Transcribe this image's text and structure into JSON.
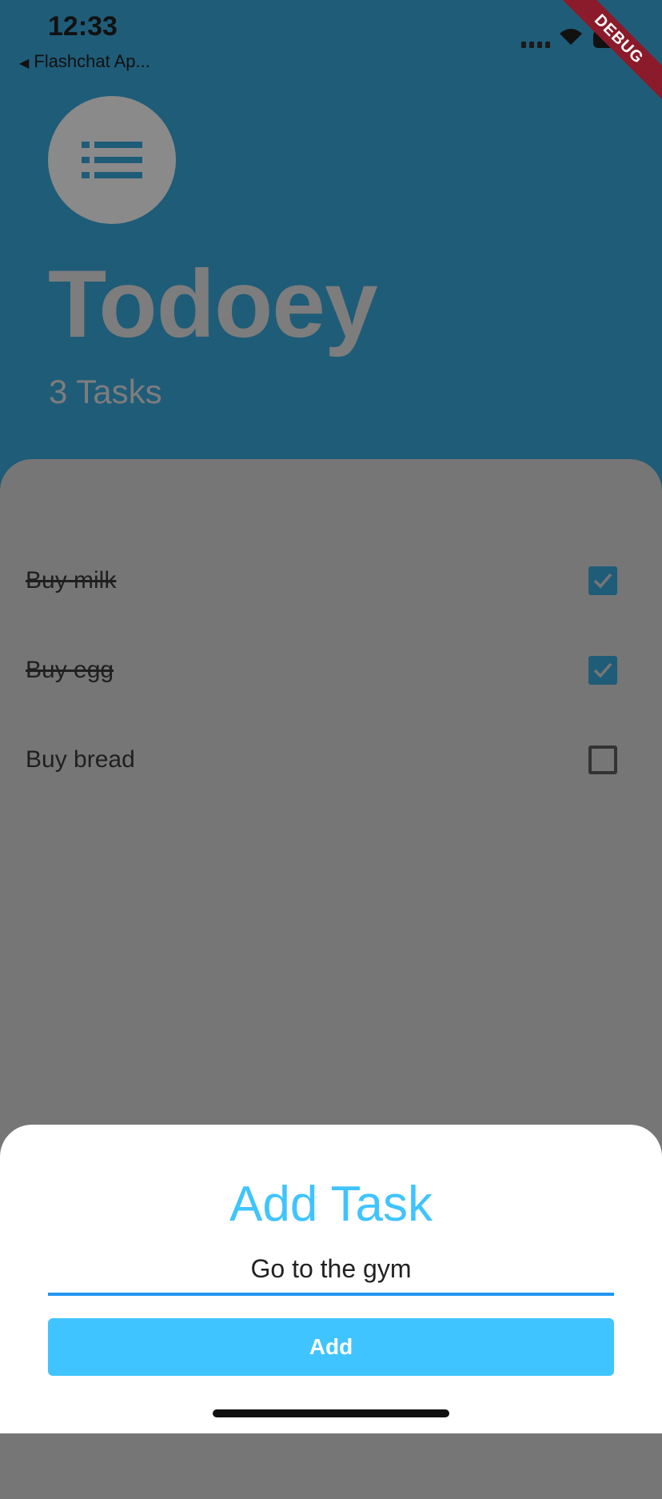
{
  "status_bar": {
    "time": "12:33",
    "back_app": "Flashchat Ap..."
  },
  "debug_banner": "DEBUG",
  "header": {
    "app_title": "Todoey",
    "task_count": "3 Tasks"
  },
  "tasks": [
    {
      "label": "Buy milk",
      "done": true
    },
    {
      "label": "Buy egg",
      "done": true
    },
    {
      "label": "Buy bread",
      "done": false
    }
  ],
  "add_task_sheet": {
    "title": "Add Task",
    "input_value": "Go to the gym",
    "button_label": "Add"
  },
  "colors": {
    "header_bg": "#1f5c78",
    "accent": "#40c4ff",
    "underline": "#2196f3",
    "overlay": "#767676"
  },
  "icons": {
    "logo": "list-icon",
    "check": "check-icon"
  }
}
